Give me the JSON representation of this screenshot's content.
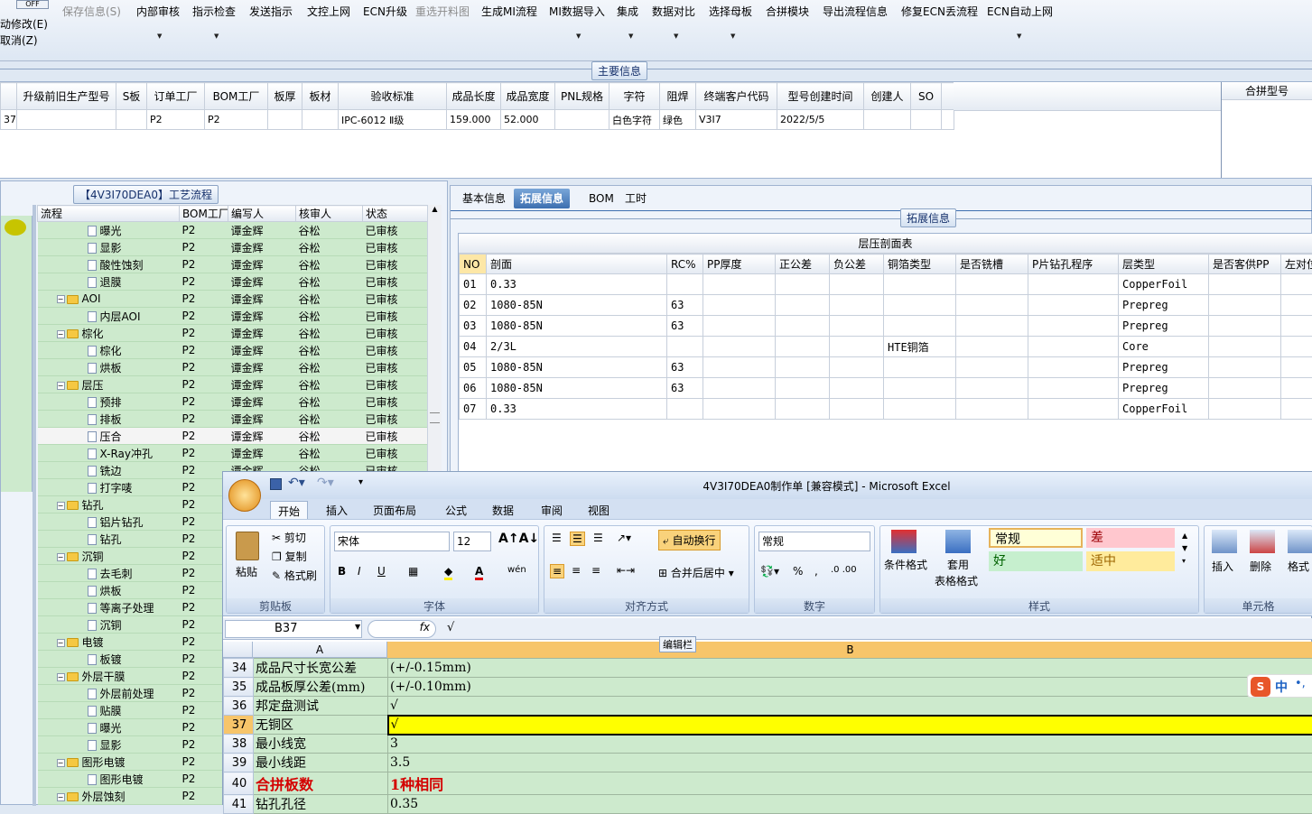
{
  "toolbar": {
    "off_label": "OFF",
    "left_line1": "动修改(E)",
    "left_line2": "取消(Z)",
    "items": [
      "保存信息(S)",
      "内部审核",
      "指示检查",
      "发送指示",
      "文控上网",
      "ECN升级",
      "重选开料图",
      "生成MI流程",
      "MI数据导入",
      "集成",
      "数据对比",
      "选择母板",
      "合拼模块",
      "导出流程信息",
      "修复ECN丢流程",
      "ECN自动上网"
    ]
  },
  "main_info": {
    "title": "主要信息",
    "headers": [
      "",
      "升级前旧生产型号",
      "S板",
      "订单工厂",
      "BOM工厂",
      "板厚",
      "板材",
      "验收标准",
      "成品长度",
      "成品宽度",
      "PNL规格",
      "字符",
      "阻焊",
      "终端客户代码",
      "型号创建时间",
      "创建人",
      "SO",
      ""
    ],
    "row": [
      "37",
      "",
      "",
      "P2",
      "P2",
      "",
      "",
      "IPC-6012 Ⅱ级",
      "159.000",
      "52.000",
      "",
      "白色字符",
      "绿色",
      "V3I7",
      "2022/5/5",
      "",
      "",
      ""
    ],
    "merge_label": "合拼型号"
  },
  "process": {
    "title": "【4V3I70DEA0】工艺流程",
    "headers": [
      "流程",
      "BOM工厂",
      "编写人",
      "核审人",
      "状态"
    ],
    "rows": [
      {
        "name": "曝光",
        "type": "doc",
        "factory": "P2",
        "writer": "谭金辉",
        "reviewer": "谷松",
        "status": "已审核"
      },
      {
        "name": "显影",
        "type": "doc",
        "factory": "P2",
        "writer": "谭金辉",
        "reviewer": "谷松",
        "status": "已审核"
      },
      {
        "name": "酸性蚀刻",
        "type": "doc",
        "factory": "P2",
        "writer": "谭金辉",
        "reviewer": "谷松",
        "status": "已审核"
      },
      {
        "name": "退膜",
        "type": "doc",
        "factory": "P2",
        "writer": "谭金辉",
        "reviewer": "谷松",
        "status": "已审核"
      },
      {
        "name": "AOI",
        "type": "folder",
        "factory": "P2",
        "writer": "谭金辉",
        "reviewer": "谷松",
        "status": "已审核"
      },
      {
        "name": "内层AOI",
        "type": "doc",
        "factory": "P2",
        "writer": "谭金辉",
        "reviewer": "谷松",
        "status": "已审核"
      },
      {
        "name": "棕化",
        "type": "folder",
        "factory": "P2",
        "writer": "谭金辉",
        "reviewer": "谷松",
        "status": "已审核"
      },
      {
        "name": "棕化",
        "type": "doc",
        "factory": "P2",
        "writer": "谭金辉",
        "reviewer": "谷松",
        "status": "已审核"
      },
      {
        "name": "烘板",
        "type": "doc",
        "factory": "P2",
        "writer": "谭金辉",
        "reviewer": "谷松",
        "status": "已审核"
      },
      {
        "name": "层压",
        "type": "folder",
        "factory": "P2",
        "writer": "谭金辉",
        "reviewer": "谷松",
        "status": "已审核"
      },
      {
        "name": "预排",
        "type": "doc",
        "factory": "P2",
        "writer": "谭金辉",
        "reviewer": "谷松",
        "status": "已审核"
      },
      {
        "name": "排板",
        "type": "doc",
        "factory": "P2",
        "writer": "谭金辉",
        "reviewer": "谷松",
        "status": "已审核"
      },
      {
        "name": "压合",
        "type": "doc",
        "factory": "P2",
        "writer": "谭金辉",
        "reviewer": "谷松",
        "status": "已审核",
        "selected": true
      },
      {
        "name": "X-Ray冲孔",
        "type": "doc",
        "factory": "P2",
        "writer": "谭金辉",
        "reviewer": "谷松",
        "status": "已审核"
      },
      {
        "name": "铣边",
        "type": "doc",
        "factory": "P2",
        "writer": "谭金辉",
        "reviewer": "谷松",
        "status": "已审核"
      },
      {
        "name": "打字唛",
        "type": "doc",
        "factory": "P2",
        "writer": "",
        "reviewer": "",
        "status": ""
      },
      {
        "name": "钻孔",
        "type": "folder",
        "factory": "P2",
        "writer": "",
        "reviewer": "",
        "status": ""
      },
      {
        "name": "铝片钻孔",
        "type": "doc",
        "factory": "P2",
        "writer": "",
        "reviewer": "",
        "status": ""
      },
      {
        "name": "钻孔",
        "type": "doc",
        "factory": "P2",
        "writer": "",
        "reviewer": "",
        "status": ""
      },
      {
        "name": "沉铜",
        "type": "folder",
        "factory": "P2",
        "writer": "",
        "reviewer": "",
        "status": ""
      },
      {
        "name": "去毛刺",
        "type": "doc",
        "factory": "P2",
        "writer": "",
        "reviewer": "",
        "status": ""
      },
      {
        "name": "烘板",
        "type": "doc",
        "factory": "P2",
        "writer": "",
        "reviewer": "",
        "status": ""
      },
      {
        "name": "等离子处理",
        "type": "doc",
        "factory": "P2",
        "writer": "",
        "reviewer": "",
        "status": ""
      },
      {
        "name": "沉铜",
        "type": "doc",
        "factory": "P2",
        "writer": "",
        "reviewer": "",
        "status": ""
      },
      {
        "name": "电镀",
        "type": "folder",
        "factory": "P2",
        "writer": "",
        "reviewer": "",
        "status": ""
      },
      {
        "name": "板镀",
        "type": "doc",
        "factory": "P2",
        "writer": "",
        "reviewer": "",
        "status": ""
      },
      {
        "name": "外层干膜",
        "type": "folder",
        "factory": "P2",
        "writer": "",
        "reviewer": "",
        "status": ""
      },
      {
        "name": "外层前处理",
        "type": "doc",
        "factory": "P2",
        "writer": "",
        "reviewer": "",
        "status": ""
      },
      {
        "name": "贴膜",
        "type": "doc",
        "factory": "P2",
        "writer": "",
        "reviewer": "",
        "status": ""
      },
      {
        "name": "曝光",
        "type": "doc",
        "factory": "P2",
        "writer": "",
        "reviewer": "",
        "status": ""
      },
      {
        "name": "显影",
        "type": "doc",
        "factory": "P2",
        "writer": "",
        "reviewer": "",
        "status": ""
      },
      {
        "name": "图形电镀",
        "type": "folder",
        "factory": "P2",
        "writer": "",
        "reviewer": "",
        "status": ""
      },
      {
        "name": "图形电镀",
        "type": "doc",
        "factory": "P2",
        "writer": "",
        "reviewer": "",
        "status": ""
      },
      {
        "name": "外层蚀刻",
        "type": "folder",
        "factory": "P2",
        "writer": "",
        "reviewer": "",
        "status": ""
      }
    ]
  },
  "tabs": [
    "基本信息",
    "拓展信息",
    "BOM",
    "工时"
  ],
  "ext_info_title": "拓展信息",
  "lamination": {
    "title": "层压剖面表",
    "headers": [
      "NO",
      "剖面",
      "RC%",
      "PP厚度",
      "正公差",
      "负公差",
      "铜箔类型",
      "是否铣槽",
      "P片钻孔程序",
      "层类型",
      "是否客供PP",
      "左对位"
    ],
    "rows": [
      [
        "01",
        "0.33",
        "",
        "",
        "",
        "",
        "",
        "",
        "",
        "CopperFoil",
        "",
        ""
      ],
      [
        "02",
        "1080-85N",
        "63",
        "",
        "",
        "",
        "",
        "",
        "",
        "Prepreg",
        "",
        ""
      ],
      [
        "03",
        "1080-85N",
        "63",
        "",
        "",
        "",
        "",
        "",
        "",
        "Prepreg",
        "",
        ""
      ],
      [
        "04",
        "2/3L",
        "",
        "",
        "",
        "",
        "HTE铜箔",
        "",
        "",
        "Core",
        "",
        ""
      ],
      [
        "05",
        "1080-85N",
        "63",
        "",
        "",
        "",
        "",
        "",
        "",
        "Prepreg",
        "",
        ""
      ],
      [
        "06",
        "1080-85N",
        "63",
        "",
        "",
        "",
        "",
        "",
        "",
        "Prepreg",
        "",
        ""
      ],
      [
        "07",
        "0.33",
        "",
        "",
        "",
        "",
        "",
        "",
        "",
        "CopperFoil",
        "",
        ""
      ]
    ]
  },
  "excel": {
    "title": "4V3I70DEA0制作单 [兼容模式] - Microsoft Excel",
    "ribbon_tabs": [
      "开始",
      "插入",
      "页面布局",
      "公式",
      "数据",
      "审阅",
      "视图"
    ],
    "clipboard": {
      "paste": "粘贴",
      "cut": "剪切",
      "copy": "复制",
      "format_painter": "格式刷",
      "label": "剪贴板"
    },
    "font": {
      "name": "宋体",
      "size": "12",
      "label": "字体"
    },
    "align": {
      "wrap": "自动换行",
      "merge": "合并后居中",
      "label": "对齐方式"
    },
    "number": {
      "format": "常规",
      "label": "数字"
    },
    "styles": {
      "cond": "条件格式",
      "table": "套用",
      "table2": "表格格式",
      "label": "样式",
      "normal": "常规",
      "bad": "差",
      "good": "好",
      "neutral": "适中"
    },
    "cells": {
      "insert": "插入",
      "delete": "删除",
      "format": "格式",
      "label": "单元格"
    },
    "name_box": "B37",
    "formula": "√",
    "edit_bar_label": "编辑栏",
    "col_a": "A",
    "col_b": "B",
    "rows": [
      {
        "n": "34",
        "a": "成品尺寸长宽公差",
        "b": "(+/-0.15mm)"
      },
      {
        "n": "35",
        "a": "成品板厚公差(mm)",
        "b": "(+/-0.10mm)"
      },
      {
        "n": "36",
        "a": "邦定盘测试",
        "b": "√"
      },
      {
        "n": "37",
        "a": "无铜区",
        "b": "√",
        "selected": true
      },
      {
        "n": "38",
        "a": "最小线宽",
        "b": "3"
      },
      {
        "n": "39",
        "a": "最小线距",
        "b": "3.5"
      },
      {
        "n": "40",
        "a": "合拼板数",
        "b": "1种相同",
        "emph": true
      },
      {
        "n": "41",
        "a": "钻孔孔径",
        "b": "0.35"
      }
    ],
    "ime": "中"
  },
  "colors": {
    "tree_green": "#cdeacd",
    "accent_blue": "#3d6fb0",
    "selected_yellow": "#ffff00",
    "emph_red": "#d40000"
  }
}
